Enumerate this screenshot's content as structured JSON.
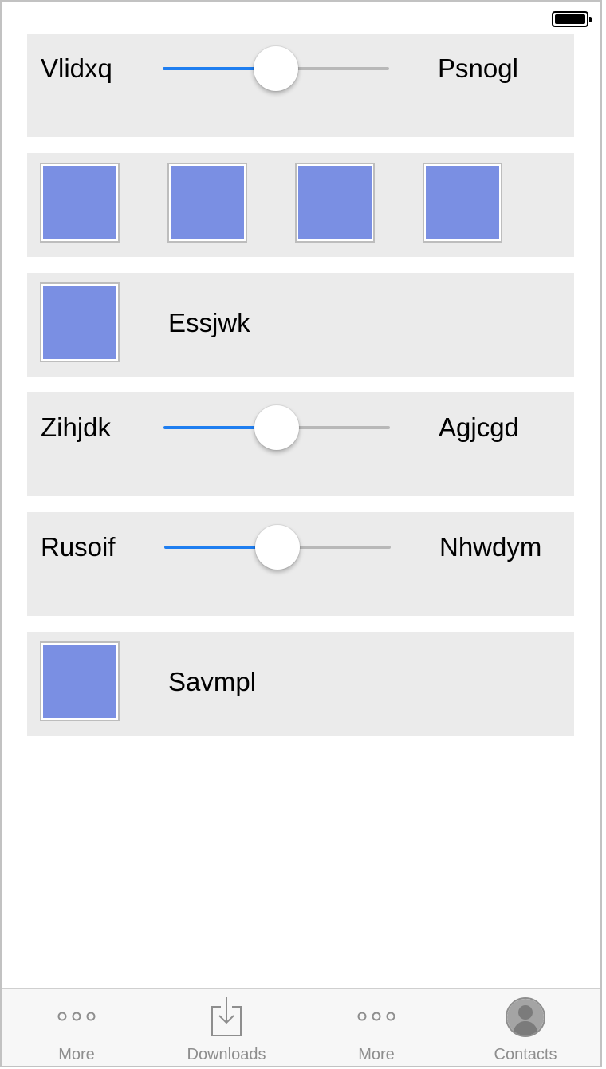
{
  "status_bar": {
    "battery_icon": "battery-full-icon"
  },
  "rows": [
    {
      "type": "slider",
      "left_label": "Vlidxq",
      "right_label": "Psnogl",
      "value": 0.5
    },
    {
      "type": "swatches",
      "count": 4,
      "color": "#7a8fe3"
    },
    {
      "type": "swatch-label",
      "label": "Essjwk",
      "color": "#7a8fe3"
    },
    {
      "type": "slider",
      "left_label": "Zihjdk",
      "right_label": "Agjcgd",
      "value": 0.5
    },
    {
      "type": "slider",
      "left_label": "Rusoif",
      "right_label": "Nhwdym",
      "value": 0.5
    },
    {
      "type": "swatch-label",
      "label": "Savmpl",
      "color": "#7a8fe3"
    }
  ],
  "tabbar": {
    "tabs": [
      {
        "label": "More",
        "icon": "more-icon"
      },
      {
        "label": "Downloads",
        "icon": "downloads-icon"
      },
      {
        "label": "More",
        "icon": "more-icon"
      },
      {
        "label": "Contacts",
        "icon": "contacts-icon"
      }
    ]
  },
  "colors": {
    "slider_min_track": "#1f7ef0",
    "slider_max_track": "#b8b8b8",
    "swatch_fill": "#7a8fe3",
    "cell_background": "#ebebeb",
    "tab_label": "#8e8e8e"
  }
}
